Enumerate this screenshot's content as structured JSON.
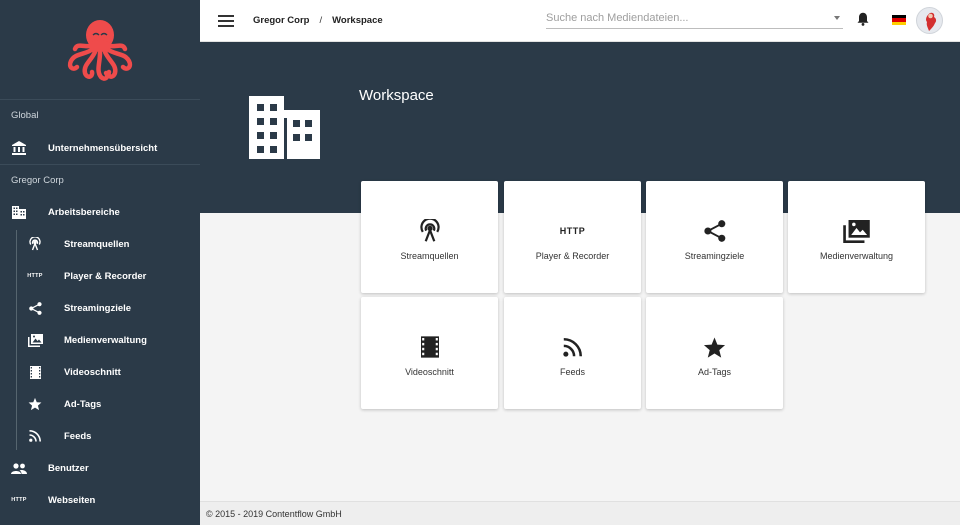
{
  "sidebar": {
    "sections": {
      "global": "Global",
      "company": "Gregor Corp"
    },
    "global_items": [
      {
        "label": "Unternehmensübersicht",
        "icon": "bank-icon"
      }
    ],
    "workspace": {
      "label": "Arbeitsbereiche",
      "icon": "building-icon"
    },
    "sub_items": [
      {
        "label": "Streamquellen",
        "icon": "antenna-icon"
      },
      {
        "label": "Player & Recorder",
        "icon": "http-icon",
        "icon_text": "HTTP"
      },
      {
        "label": "Streamingziele",
        "icon": "share-icon"
      },
      {
        "label": "Medienverwaltung",
        "icon": "photo-library-icon"
      },
      {
        "label": "Videoschnitt",
        "icon": "film-icon"
      },
      {
        "label": "Ad-Tags",
        "icon": "star-icon"
      },
      {
        "label": "Feeds",
        "icon": "rss-icon"
      }
    ],
    "bottom_items": [
      {
        "label": "Benutzer",
        "icon": "people-icon"
      },
      {
        "label": "Webseiten",
        "icon": "http-icon",
        "icon_text": "HTTP"
      }
    ]
  },
  "topbar": {
    "breadcrumb": [
      "Gregor Corp",
      "Workspace"
    ],
    "breadcrumb_separator": "/",
    "search_placeholder": "Suche nach Mediendateien..."
  },
  "hero": {
    "title": "Workspace"
  },
  "tiles": [
    {
      "label": "Streamquellen",
      "icon": "antenna-icon"
    },
    {
      "label": "Player & Recorder",
      "icon": "http-icon",
      "icon_text": "HTTP"
    },
    {
      "label": "Streamingziele",
      "icon": "share-icon"
    },
    {
      "label": "Medienverwaltung",
      "icon": "photo-library-icon"
    },
    {
      "label": "Videoschnitt",
      "icon": "film-icon"
    },
    {
      "label": "Feeds",
      "icon": "rss-icon"
    },
    {
      "label": "Ad-Tags",
      "icon": "star-icon"
    }
  ],
  "footer": {
    "text": "© 2015 - 2019 Contentflow GmbH"
  },
  "colors": {
    "sidebar_bg": "#2b3a48",
    "logo_red": "#ef4b4b",
    "content_bg": "#f4f4f4"
  }
}
